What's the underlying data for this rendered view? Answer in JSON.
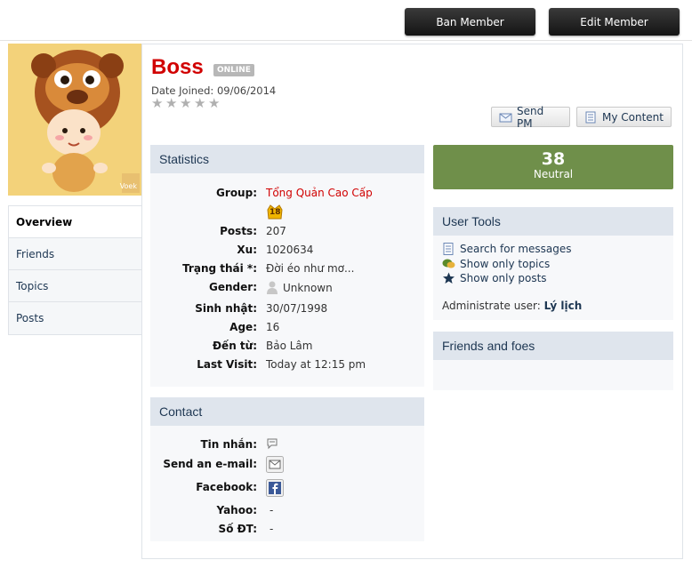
{
  "header": {
    "ban_label": "Ban Member",
    "edit_label": "Edit Member"
  },
  "tabs": [
    {
      "label": "Overview"
    },
    {
      "label": "Friends"
    },
    {
      "label": "Topics"
    },
    {
      "label": "Posts"
    }
  ],
  "profile": {
    "name": "Boss",
    "status_badge": "ONLINE",
    "joined": "Date Joined: 09/06/2014",
    "send_pm_label": "Send PM",
    "my_content_label": "My Content",
    "avatar_watermark": "Voek"
  },
  "statistics": {
    "title": "Statistics",
    "rows": [
      {
        "label": "Group:",
        "value": "Tổng Quản Cao Cấp"
      },
      {
        "label": "Posts:",
        "value": "207"
      },
      {
        "label": "Xu:",
        "value": "1020634"
      },
      {
        "label": "Trạng thái *:",
        "value": "Đời éo như mơ..."
      },
      {
        "label": "Gender:",
        "value": "Unknown"
      },
      {
        "label": "Sinh nhật:",
        "value": "30/07/1998"
      },
      {
        "label": "Age:",
        "value": "16"
      },
      {
        "label": "Đến từ:",
        "value": "Bảo Lâm"
      },
      {
        "label": "Last Visit:",
        "value": "Today at 12:15 pm"
      }
    ],
    "group_badge_number": "18",
    "group_color": "#d10000"
  },
  "contact": {
    "title": "Contact",
    "rows": [
      {
        "label": "Tin nhắn:",
        "value": ""
      },
      {
        "label": "Send an e-mail:",
        "value": ""
      },
      {
        "label": "Facebook:",
        "value": ""
      },
      {
        "label": "Yahoo:",
        "value": "-"
      },
      {
        "label": "Số ĐT:",
        "value": "-"
      }
    ]
  },
  "reputation": {
    "value": "38",
    "label": "Neutral",
    "color": "#6f8f4a"
  },
  "user_tools": {
    "title": "User Tools",
    "items": [
      {
        "label": "Search for messages",
        "icon": "document-icon"
      },
      {
        "label": "Show only topics",
        "icon": "chat-bubble-icon"
      },
      {
        "label": "Show only posts",
        "icon": "star-icon"
      }
    ],
    "admin_prefix": "Administrate user:",
    "admin_link": "Lý lịch"
  },
  "friends_foes": {
    "title": "Friends and foes"
  }
}
